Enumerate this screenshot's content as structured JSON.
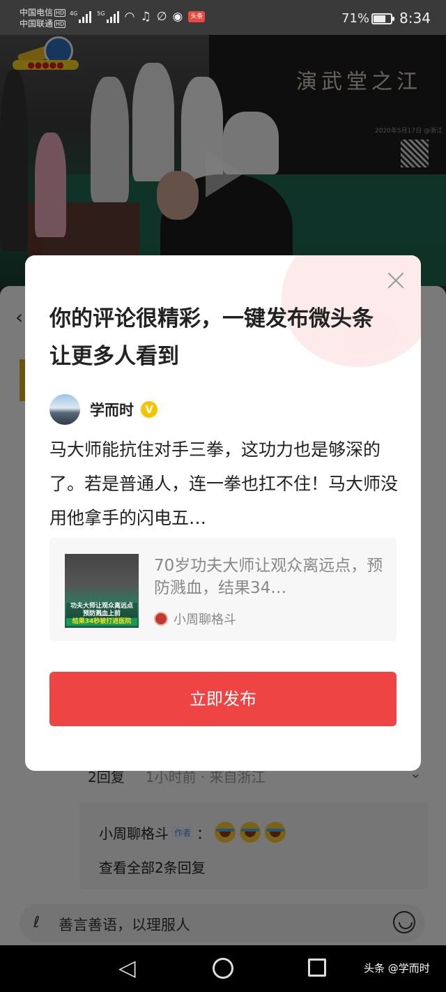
{
  "status_bar": {
    "carrier_1": "中国电信",
    "carrier_2": "中国联通",
    "hd_label": "HD",
    "net_4g": "4G",
    "net_5g": "5G",
    "toutiao_badge": "头条",
    "battery_percent": "71%",
    "battery_level": 0.71,
    "time": "8:34"
  },
  "video": {
    "banner_text": "演武堂之江",
    "banner_date": "2020年5月17日 @浙江",
    "icons": [
      "play-icon"
    ]
  },
  "background_page": {
    "reply_count_label": "2回复",
    "reply_count_suffix": "›",
    "reply_meta": "1小时前 · 来自浙江",
    "reply_user": "小周聊格斗",
    "author_tag": "作者",
    "colon": "：",
    "view_all_replies": "查看全部2条回复",
    "comment_placeholder": "善言善语，以理服人"
  },
  "modal": {
    "title": "你的评论很精彩，一键发布微头条让更多人看到",
    "user_name": "学而时",
    "verified_glyph": "V",
    "comment_text": "马大师能抗住对手三拳，这功力也是够深的了。若是普通人，连一拳也扛不住！马大师没用他拿手的闪电五…",
    "article": {
      "title": "70岁功夫大师让观众离远点，预防溅血，结果34…",
      "thumb_line_1": "功夫大师让观众离远点 预防溅血上前",
      "thumb_line_2": "结果34秒被打进医院",
      "source_name": "小周聊格斗"
    },
    "publish_label": "立即发布"
  },
  "nav_bar": {
    "watermark": "头条 @学而时"
  },
  "colors": {
    "accent_red": "#ef4444",
    "verified_yellow": "#f5c400"
  }
}
